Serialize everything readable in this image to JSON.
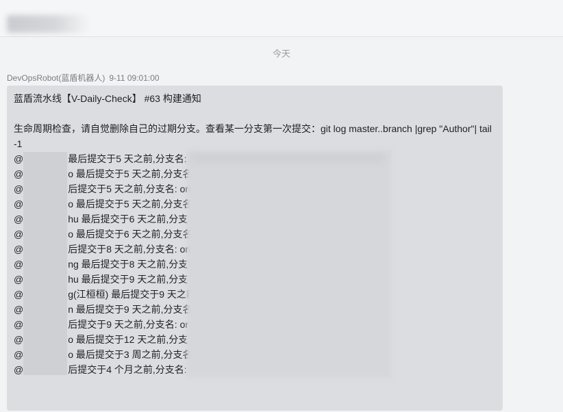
{
  "chat": {
    "title_redacted": true
  },
  "date_divider": "今天",
  "message": {
    "sender": "DevOpsRobot(蓝盾机器人)",
    "time": "9-11 09:01:00",
    "title": "蓝盾流水线【V-Daily-Check】 #63 构建通知",
    "intro": "生命周期检查，请自觉删除自己的过期分支。查看某一分支第一次提交：git log master..branch |grep \"Author\"| tail -1",
    "at": "@",
    "rows": [
      "最后提交于5 天之前,分支名:",
      "o 最后提交于5 天之前,分支名",
      "后提交于5 天之前,分支名: orig",
      "o 最后提交于5 天之前,分支名",
      "hu 最后提交于6 天之前,分支",
      "o 最后提交于6 天之前,分支名",
      "后提交于8 天之前,分支名: orig",
      "ng 最后提交于8 天之前,分支名",
      "hu 最后提交于9 天之前,分支",
      "g(江桓桓) 最后提交于9 天之前",
      "n 最后提交于9 天之前,分支名",
      "后提交于9 天之前,分支名: or",
      "o 最后提交于12 天之前,分支",
      "o 最后提交于3 周之前,分支名",
      "后提交于4 个月之前,分支名:"
    ]
  }
}
